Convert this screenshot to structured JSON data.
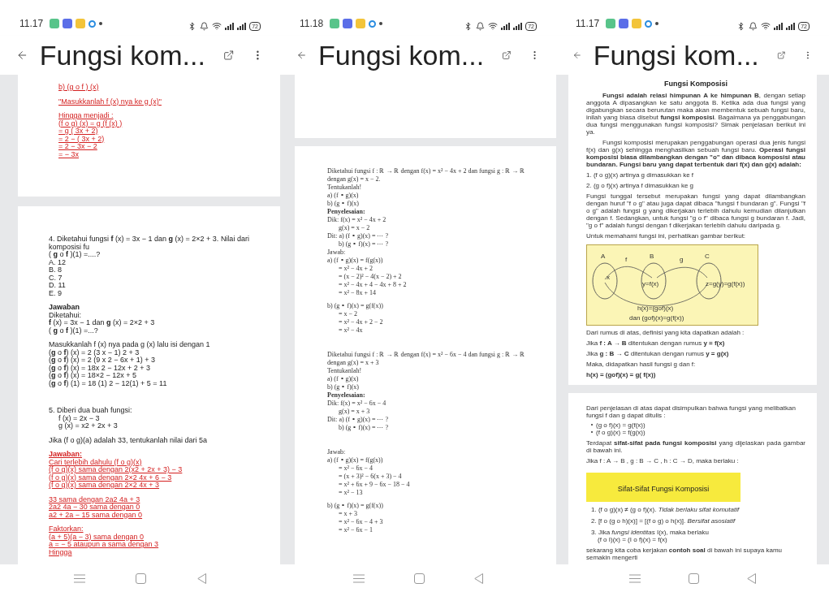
{
  "panels": [
    {
      "kind": "article",
      "status_bar": {
        "time": "11.17",
        "battery": "72"
      },
      "app_bar": {
        "title": "Fungsi kom..."
      },
      "pages": [
        {
          "blocks": [
            {
              "kind": "red",
              "lines": [
                {
                  "text": "b) (g o f ) (x)"
                }
              ]
            },
            {
              "kind": "red",
              "lines": [
                {
                  "text": "\"Masukkanlah f (x) nya ke g (x)\""
                }
              ]
            },
            {
              "kind": "red",
              "lines": [
                {
                  "text": "Hingga menjadi :"
                },
                {
                  "text": "(f o g) (x) = g (f (x) )"
                },
                {
                  "text": "= g ( 3x + 2)"
                },
                {
                  "text": "= 2 − ( 3x + 2)"
                },
                {
                  "text": "= 2 − 3x − 2"
                },
                {
                  "text": "= − 3x"
                }
              ]
            }
          ]
        },
        {
          "blocks": [
            {
              "kind": "plain",
              "lines": [
                {
                  "text": "4. Diketahui fungsi **f** (x) = 3x − 1 dan **g** (x) = 2×2 + 3. Nilai dari komposisi fu"
                },
                {
                  "text": "( **g** o **f** )(1) =....?"
                },
                {
                  "text": "A. 12"
                },
                {
                  "text": "B. 8"
                },
                {
                  "text": "C. 7"
                },
                {
                  "text": "D. 11"
                },
                {
                  "text": "E. 9"
                }
              ]
            },
            {
              "kind": "plain",
              "lines": [
                {
                  "text": "Jawaban",
                  "bold": true
                },
                {
                  "text": "Diketahui:"
                },
                {
                  "text": "**f** (x) = 3x − 1 dan **g** (x) = 2×2 + 3"
                },
                {
                  "text": "( **g** o **f** )(1) =...?"
                }
              ]
            },
            {
              "kind": "plain",
              "lines": [
                {
                  "text": "Masukkanlah f (x) nya pada g (x) lalu isi dengan 1"
                },
                {
                  "text": "(**g** o **f**) (x) = 2 (3 x − 1) 2 + 3"
                },
                {
                  "text": "(**g** o **f**) (x) = 2 (9 x 2 − 6x + 1) + 3"
                },
                {
                  "text": "(**g** o **f**) (x) = 18x 2 − 12x + 2 + 3"
                },
                {
                  "text": "(**g** o **f**) (x) = 18×2 − 12x + 5"
                },
                {
                  "text": "(**g** o **f**) (1) = 18 (1) 2 − 12(1) + 5 = 11"
                }
              ]
            },
            {
              "kind": "gap_plain",
              "lines": [
                {
                  "text": "5. Diberi dua buah fungsi:",
                  "children": [
                    {
                      "text": "f (x) = 2x − 3"
                    },
                    {
                      "text": "g (x) = x2 + 2x + 3"
                    }
                  ]
                }
              ]
            },
            {
              "kind": "plain",
              "lines": [
                {
                  "text": "Jika (f o g)(a) adalah 33, tentukanlah nilai dari 5a"
                }
              ]
            },
            {
              "kind": "red",
              "lines": [
                {
                  "text": "Jawaban:",
                  "bold": true
                },
                {
                  "text": "Cari terlebih dahulu (f o g)(x)"
                },
                {
                  "text": "(f o g)(x) sama dengan 2(x2 + 2x + 3) − 3"
                },
                {
                  "text": "(f o g)(x) sama dengan 2×2 4x + 6 − 3"
                },
                {
                  "text": "(f o g)(x) sama dengan 2×2 4x + 3"
                }
              ]
            },
            {
              "kind": "red",
              "lines": [
                {
                  "text": "33 sama dengan 2a2 4a + 3"
                },
                {
                  "text": "2a2 4a − 30 sama dengan 0"
                },
                {
                  "text": "a2 + 2a − 15 sama dengan 0"
                }
              ]
            },
            {
              "kind": "red",
              "lines": [
                {
                  "text": "Faktorkan:"
                },
                {
                  "text": "(a + 5)(a − 3) sama dengan 0"
                },
                {
                  "text": "a = − 5 ataupun a sama dengan 3"
                },
                {
                  "text": "Hingga"
                }
              ]
            }
          ]
        }
      ]
    },
    {
      "kind": "pdf",
      "status_bar": {
        "time": "11.18",
        "battery": "72"
      },
      "app_bar": {
        "title": "Fungsi kom..."
      },
      "pages": [
        {
          "blocks": [
            {
              "kind": "math",
              "lines": [
                {
                  "text": "Diketahui fungsi f : ℝ → ℝ dengan f(x) = x² − 4x + 2 dan fungsi g : ℝ → ℝ"
                },
                {
                  "text": "dengan g(x) = x − 2."
                },
                {
                  "text": "Tentukanlah!"
                },
                {
                  "text": "a) (f ∘ g)(x)"
                },
                {
                  "text": "b) (g ∘ f)(x)"
                },
                {
                  "text": "Penyelesaian:",
                  "bold": true
                },
                {
                  "text": "Dik: f(x) = x² − 4x + 2",
                  "children": [
                    {
                      "text": "g(x) = x − 2"
                    }
                  ]
                },
                {
                  "text": "Dit: a) (f ∘ g)(x) = ⋯ ?",
                  "children": [
                    {
                      "text": "b) (g ∘ f)(x) = ⋯ ?"
                    }
                  ]
                },
                {
                  "text": "Jawab:"
                },
                {
                  "text": "a) (f ∘ g)(x) = f(g(x))",
                  "children": [
                    {
                      "text": "= x² − 4x + 2"
                    },
                    {
                      "text": "= (x − 2)² − 4(x − 2) + 2"
                    },
                    {
                      "text": "= x² − 4x + 4 − 4x + 8 + 2"
                    },
                    {
                      "text": "= x² − 8x + 14"
                    }
                  ]
                }
              ]
            },
            {
              "kind": "math",
              "lines": [
                {
                  "text": "b) (g ∘ f)(x) = g(f(x))",
                  "children": [
                    {
                      "text": "= x − 2"
                    },
                    {
                      "text": "= x² − 4x + 2 − 2"
                    },
                    {
                      "text": "= x² − 4x"
                    }
                  ]
                }
              ]
            },
            {
              "kind": "gap_math",
              "lines": [
                {
                  "text": "Diketahui fungsi f : ℝ → ℝ dengan f(x) = x² − 6x − 4 dan fungsi g : ℝ → ℝ"
                },
                {
                  "text": "dengan g(x) = x + 3"
                },
                {
                  "text": "Tentukanlah!"
                },
                {
                  "text": "a) (f ∘ g)(x)"
                },
                {
                  "text": "b) (g ∘ f)(x)"
                },
                {
                  "text": "Penyelesaian:",
                  "bold": true
                },
                {
                  "text": "Dik: f(x) = x² − 6x − 4",
                  "children": [
                    {
                      "text": "g(x) = x + 3"
                    }
                  ]
                },
                {
                  "text": "Dit: a) (f ∘ g)(x) = ⋯ ?",
                  "children": [
                    {
                      "text": "b) (g ∘ f)(x) = ⋯ ?"
                    }
                  ]
                }
              ]
            },
            {
              "kind": "gap_math",
              "lines": [
                {
                  "text": "Jawab:"
                },
                {
                  "text": "a) (f ∘ g)(x) = f(g(x))",
                  "children": [
                    {
                      "text": "= x² − 6x − 4"
                    },
                    {
                      "text": "= (x + 3)² − 6(x + 3) − 4"
                    },
                    {
                      "text": "= x² + 6x + 9 − 6x − 18 − 4"
                    },
                    {
                      "text": "= x² − 13"
                    }
                  ]
                }
              ]
            },
            {
              "kind": "math",
              "lines": [
                {
                  "text": "b) (g ∘ f)(x) = g(f(x))",
                  "children": [
                    {
                      "text": "= x + 3"
                    },
                    {
                      "text": "= x² − 6x − 4 + 3"
                    },
                    {
                      "text": "= x² − 6x − 1"
                    }
                  ]
                }
              ]
            }
          ]
        }
      ]
    },
    {
      "kind": "doc",
      "status_bar": {
        "time": "11.17",
        "battery": "72"
      },
      "app_bar": {
        "title": "Fungsi kom..."
      },
      "pages": [
        {
          "blocks": [
            {
              "kind": "title",
              "lines": [
                {
                  "text": "Fungsi Komposisi"
                }
              ]
            },
            {
              "kind": "paragraph",
              "lines": [
                {
                  "text": "**Fungsi adalah relasi himpunan A ke himpunan B**, dengan setiap anggota A dipasangkan ke satu anggota B. Ketika ada dua fungsi yang digabungkan secara berurutan maka akan membentuk sebuah fungsi baru, inilah yang biasa disebut **fungsi komposisi**. Bagaimana ya penggabungan dua fungsi menggunakan fungsi komposisi? Simak penjelasan berikut ini ya."
                }
              ]
            },
            {
              "kind": "paragraph",
              "lines": [
                {
                  "text": "Fungsi komposisi merupakan penggabungan operasi dua jenis fungsi f(x) dan g(x) sehingga menghasilkan sebuah fungsi baru. **Operasi fungsi komposisi biasa dilambangkan dengan \"o\" dan dibaca komposisi atau bundaran. Fungsi baru yang dapat terbentuk dari f(x) dan g(x) adalah:**"
                }
              ]
            },
            {
              "kind": "doc_line",
              "lines": [
                {
                  "text": "1. (f o g)(x) artinya g dimasukkan ke f"
                }
              ]
            },
            {
              "kind": "doc_line",
              "lines": [
                {
                  "text": "2. (g o f)(x) artinya f dimasukkan ke g"
                }
              ]
            },
            {
              "kind": "justified",
              "lines": [
                {
                  "text": "Fungsi tunggal tersebut merupakan fungsi yang dapat dilambangkan dengan huruf \"f o g\" atau juga dapat dibaca \"fungsi f bundaran g\". Fungsi \"f o g\" adalah fungsi g yang dikerjakan terlebih dahulu kemudian dilanjutkan dengan f. Sedangkan, untuk fungsi \"g o f\" dibaca fungsi g bundaran f. Jadi, \"g o f\" adalah fungsi dengan f dikerjakan terlebih dahulu daripada g."
                }
              ]
            },
            {
              "kind": "doc_line",
              "lines": [
                {
                  "text": "Untuk memahami fungsi ini, perhatikan gambar berikut:"
                }
              ]
            },
            {
              "kind": "diagram",
              "labels": {
                "set_a": "A",
                "set_b": "B",
                "set_c": "C",
                "map_f": "f",
                "map_g": "g",
                "element_x": "x",
                "element_y": "y=f(x)",
                "element_z": "z=g(y)=g(f(x))",
                "composite": "h(x)=(gof)(x)",
                "equality": "dan (gof)(x)=g(f(x))"
              }
            },
            {
              "kind": "doc_line",
              "lines": [
                {
                  "text": "Dari rumus di atas, definisi yang kita dapatkan adalah :"
                }
              ]
            },
            {
              "kind": "doc_line",
              "lines": [
                {
                  "text": "Jika **f : A → B** ditentukan dengan rumus **y = f(x)**"
                }
              ]
            },
            {
              "kind": "doc_line",
              "lines": [
                {
                  "text": "Jika **g : B → C** ditentukan dengan rumus **y = g(x)**"
                }
              ]
            },
            {
              "kind": "doc_line",
              "lines": [
                {
                  "text": "Maka, didapatkan hasil fungsi g dan f:"
                }
              ]
            },
            {
              "kind": "doc_line",
              "lines": [
                {
                  "text": "h(x) = (gof)(x) = g( f(x))",
                  "bold": true
                }
              ]
            }
          ]
        },
        {
          "blocks": [
            {
              "kind": "doc_line",
              "lines": [
                {
                  "text": "Dari penjelasan di atas dapat disimpulkan bahwa fungsi yang melibatkan fungsi f dan g dapat ditulis :"
                }
              ]
            },
            {
              "kind": "bullets",
              "lines": [
                {
                  "text": "(g o f)(x) = g(f(x))"
                },
                {
                  "text": "(f o g)(x) = f(g(x))"
                }
              ]
            },
            {
              "kind": "justified",
              "lines": [
                {
                  "text": "Terdapat **sifat-sifat pada fungsi komposisi** yang dijelaskan pada gambar di bawah ini."
                }
              ]
            },
            {
              "kind": "doc_line",
              "lines": [
                {
                  "text": "Jika f : A → B , g : B → C , h : C → D, maka berlaku :"
                }
              ]
            },
            {
              "kind": "banner",
              "lines": [
                {
                  "text": "Sifat-Sifat Fungsi Komposisi"
                }
              ]
            },
            {
              "kind": "property",
              "lines": [
                {
                  "text": "1. (f o g)(x) ≠ (g o f)(x). *Tidak berlaku sifat komutatif*"
                }
              ]
            },
            {
              "kind": "property",
              "lines": [
                {
                  "text": "2. [f o (g o h)(x)] = [(f o g) o h(x)]. *Bersifat asosiatif*"
                }
              ]
            },
            {
              "kind": "property",
              "lines": [
                {
                  "text": "3. Jika *fungsi identitas* I(x), maka berlaku",
                  "children": [
                    {
                      "text": "(f o I)(x) = (I o f)(x) = f(x)"
                    }
                  ]
                }
              ]
            },
            {
              "kind": "doc_line",
              "lines": [
                {
                  "text": "sekarang kita coba kerjakan **contoh soal** di bawah ini supaya kamu semakin mengerti"
                }
              ]
            }
          ]
        }
      ]
    }
  ]
}
